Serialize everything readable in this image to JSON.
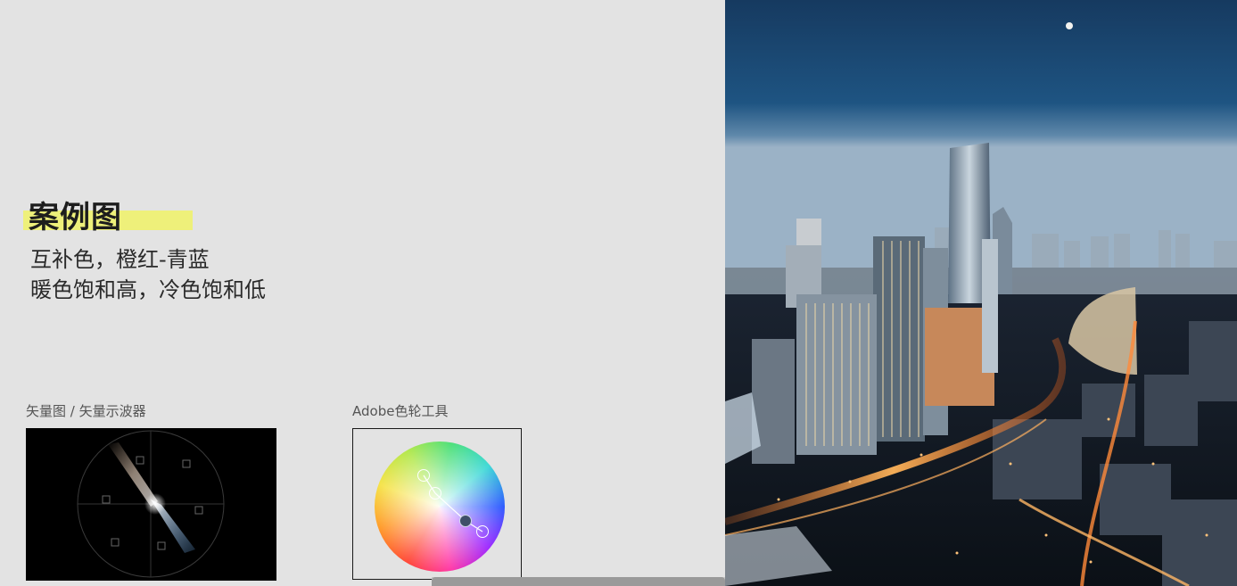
{
  "slide": {
    "title": "案例图",
    "subtitle_line1": "互补色，橙红-青蓝",
    "subtitle_line2": "暖色饱和高，冷色饱和低"
  },
  "captions": {
    "vectorscope": "矢量图 / 矢量示波器",
    "color_wheel": "Adobe色轮工具"
  },
  "colors": {
    "highlight": "#eef07a",
    "background": "#e3e3e3",
    "sky_top": "#16385d",
    "city_lights": "#ff9a2a"
  },
  "icons": {
    "vectorscope": "vectorscope-graph",
    "color_wheel": "color-wheel",
    "photo": "city-night-photo"
  }
}
